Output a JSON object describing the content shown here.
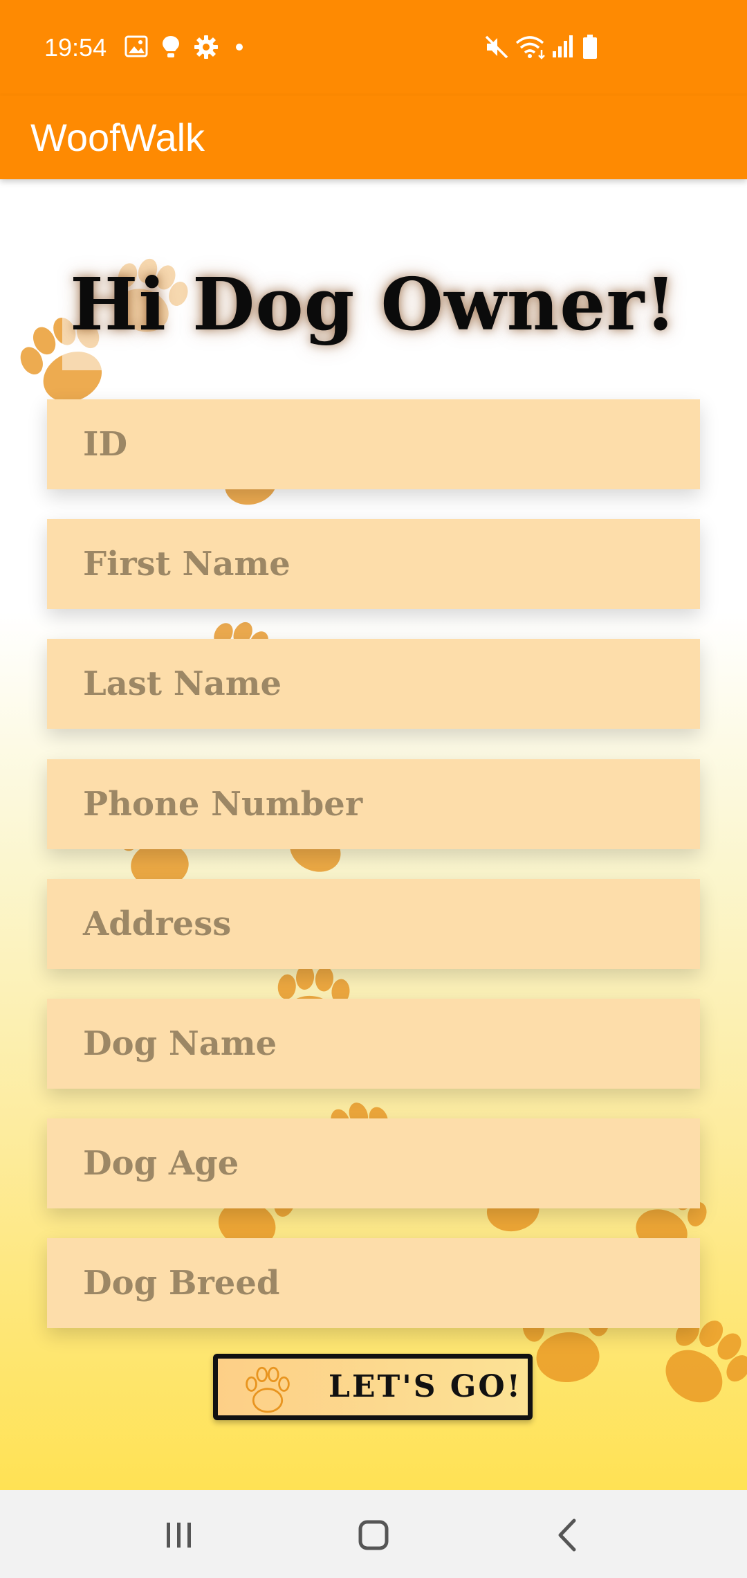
{
  "status_bar": {
    "time": "19:54",
    "left_icons": [
      "image-icon",
      "lightbulb-icon",
      "gear-icon",
      "dot-icon"
    ],
    "right_icons": [
      "mute-icon",
      "wifi-icon",
      "signal-icon",
      "battery-icon"
    ],
    "background_color": "#FE8A02"
  },
  "app_bar": {
    "title": "WoofWalk",
    "background_color": "#FE8A02"
  },
  "main": {
    "greeting": "Hi Dog Owner!",
    "fields": [
      {
        "placeholder": "ID",
        "value": ""
      },
      {
        "placeholder": "First Name",
        "value": ""
      },
      {
        "placeholder": "Last Name",
        "value": ""
      },
      {
        "placeholder": "Phone Number",
        "value": ""
      },
      {
        "placeholder": "Address",
        "value": ""
      },
      {
        "placeholder": "Dog Name",
        "value": ""
      },
      {
        "placeholder": "Dog Age",
        "value": ""
      },
      {
        "placeholder": "Dog Breed",
        "value": ""
      }
    ],
    "submit_button": {
      "label": "LET'S GO!",
      "icon": "paw-icon"
    },
    "background_decoration": "paw-print-icon"
  },
  "nav_bar": {
    "buttons": [
      "recents-icon",
      "home-icon",
      "back-icon"
    ]
  },
  "colors": {
    "accent": "#FE8A02",
    "field_background": "#FDDDAA",
    "placeholder_text": "#9C8765",
    "paw_print": "#E8941F"
  }
}
